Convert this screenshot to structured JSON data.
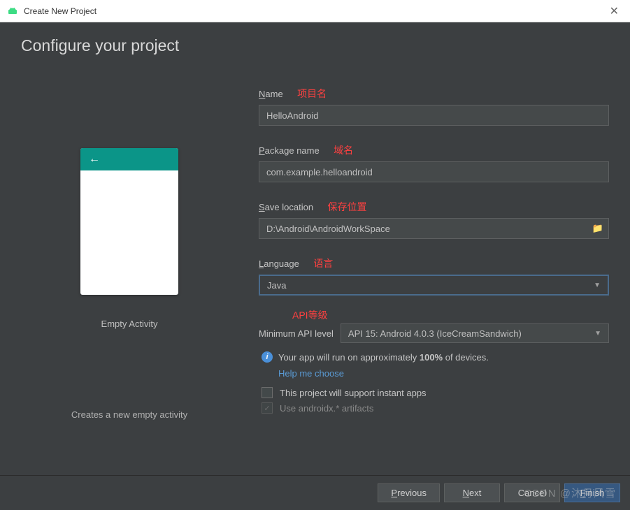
{
  "window": {
    "title": "Create New Project"
  },
  "heading": "Configure your project",
  "preview": {
    "label": "Empty Activity",
    "description": "Creates a new empty activity"
  },
  "fields": {
    "name": {
      "label_prefix": "N",
      "label_rest": "ame",
      "annotation": "项目名",
      "value": "HelloAndroid"
    },
    "package": {
      "label_prefix": "P",
      "label_rest": "ackage name",
      "annotation": "域名",
      "value": "com.example.helloandroid"
    },
    "location": {
      "label_prefix": "S",
      "label_rest": "ave location",
      "annotation": "保存位置",
      "value": "D:\\Android\\AndroidWorkSpace"
    },
    "language": {
      "label_prefix": "L",
      "label_rest": "anguage",
      "annotation": "语言",
      "value": "Java"
    },
    "api": {
      "annotation": "API等级",
      "label": "Minimum API level",
      "value": "API 15: Android 4.0.3 (IceCreamSandwich)"
    }
  },
  "info": {
    "text_pre": "Your app will run on approximately ",
    "text_bold": "100%",
    "text_post": " of devices.",
    "help": "Help me choose"
  },
  "checkboxes": {
    "instant": "This project will support instant apps",
    "androidx": "Use androidx.* artifacts"
  },
  "buttons": {
    "previous_u": "P",
    "previous_rest": "revious",
    "next_u": "N",
    "next_rest": "ext",
    "cancel": "Cancel",
    "finish_u": "F",
    "finish_rest": "inish"
  },
  "watermark": "CSDN @沐月风雪"
}
